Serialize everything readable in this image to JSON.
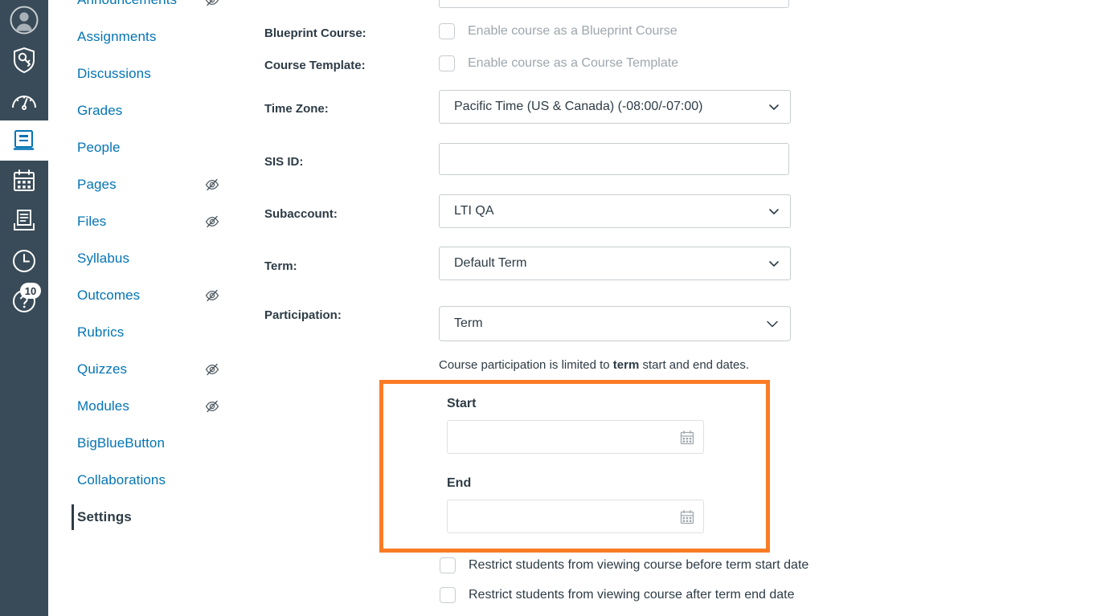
{
  "global_nav": {
    "items": [
      {
        "name": "account",
        "icon": "user-avatar-icon",
        "label": "Account",
        "active": false,
        "badge": ""
      },
      {
        "name": "admin",
        "icon": "shield-key-icon",
        "label": "Admin",
        "active": false,
        "badge": ""
      },
      {
        "name": "dashboard",
        "icon": "gauge-icon",
        "label": "Dashboard",
        "active": false,
        "badge": ""
      },
      {
        "name": "courses",
        "icon": "book-icon",
        "label": "Courses",
        "active": true,
        "badge": ""
      },
      {
        "name": "calendar",
        "icon": "calendar-icon",
        "label": "Calendar",
        "active": false,
        "badge": ""
      },
      {
        "name": "inbox",
        "icon": "inbox-tray-icon",
        "label": "Inbox",
        "active": false,
        "badge": ""
      },
      {
        "name": "history",
        "icon": "clock-icon",
        "label": "History",
        "active": false,
        "badge": ""
      },
      {
        "name": "help",
        "icon": "question-mark-icon",
        "label": "Help",
        "active": false,
        "badge": "10"
      }
    ]
  },
  "course_nav": {
    "items": [
      {
        "label": "Announcements",
        "hidden_icon": true,
        "active": false
      },
      {
        "label": "Assignments",
        "hidden_icon": false,
        "active": false
      },
      {
        "label": "Discussions",
        "hidden_icon": false,
        "active": false
      },
      {
        "label": "Grades",
        "hidden_icon": false,
        "active": false
      },
      {
        "label": "People",
        "hidden_icon": false,
        "active": false
      },
      {
        "label": "Pages",
        "hidden_icon": true,
        "active": false
      },
      {
        "label": "Files",
        "hidden_icon": true,
        "active": false
      },
      {
        "label": "Syllabus",
        "hidden_icon": false,
        "active": false
      },
      {
        "label": "Outcomes",
        "hidden_icon": true,
        "active": false
      },
      {
        "label": "Rubrics",
        "hidden_icon": false,
        "active": false
      },
      {
        "label": "Quizzes",
        "hidden_icon": true,
        "active": false
      },
      {
        "label": "Modules",
        "hidden_icon": true,
        "active": false
      },
      {
        "label": "BigBlueButton",
        "hidden_icon": false,
        "active": false
      },
      {
        "label": "Collaborations",
        "hidden_icon": false,
        "active": false
      },
      {
        "label": "Settings",
        "hidden_icon": false,
        "active": true
      }
    ]
  },
  "settings_form": {
    "blueprint_course": {
      "label": "Blueprint Course:",
      "checkbox_label": "Enable course as a Blueprint Course",
      "checked": false,
      "disabled": true
    },
    "course_template": {
      "label": "Course Template:",
      "checkbox_label": "Enable course as a Course Template",
      "checked": false,
      "disabled": true
    },
    "time_zone": {
      "label": "Time Zone:",
      "value": "Pacific Time (US & Canada) (-08:00/-07:00)"
    },
    "sis_id": {
      "label": "SIS ID:",
      "value": "",
      "placeholder": ""
    },
    "subaccount": {
      "label": "Subaccount:",
      "value": "LTI QA"
    },
    "term": {
      "label": "Term:",
      "value": "Default Term"
    },
    "participation": {
      "label": "Participation:",
      "value": "Term"
    },
    "participation_help": {
      "prefix": "Course participation is limited to ",
      "emphasis": "term",
      "suffix": " start and end dates."
    },
    "dates": {
      "start_label": "Start",
      "start_value": "",
      "end_label": "End",
      "end_value": "",
      "highlight_color": "#F97C25",
      "calendar_icon": "calendar-icon"
    },
    "restrictions": [
      {
        "label": "Restrict students from viewing course before term start date",
        "checked": false
      },
      {
        "label": "Restrict students from viewing course after term end date",
        "checked": false
      }
    ]
  },
  "colors": {
    "nav_background": "#394B58",
    "link_blue": "#0374B5",
    "text_dark": "#2D3B45",
    "text_muted": "#9EA6AD",
    "border": "#C7CDD1",
    "highlight_orange": "#F97C25"
  }
}
